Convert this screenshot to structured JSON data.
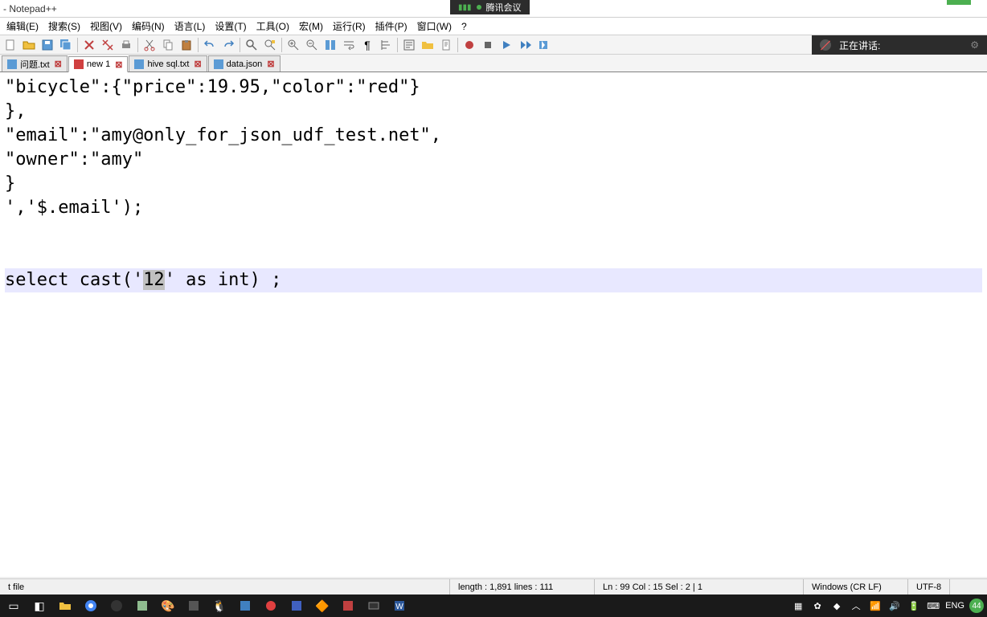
{
  "titlebar": {
    "title": "- Notepad++"
  },
  "meeting": {
    "app_name": "腾讯会议"
  },
  "menus": [
    {
      "label": "编辑(E)"
    },
    {
      "label": "搜索(S)"
    },
    {
      "label": "视图(V)"
    },
    {
      "label": "编码(N)"
    },
    {
      "label": "语言(L)"
    },
    {
      "label": "设置(T)"
    },
    {
      "label": "工具(O)"
    },
    {
      "label": "宏(M)"
    },
    {
      "label": "运行(R)"
    },
    {
      "label": "插件(P)"
    },
    {
      "label": "窗口(W)"
    },
    {
      "label": "?"
    }
  ],
  "speaking": {
    "label": "正在讲话:"
  },
  "tabs": [
    {
      "label": "问题.txt",
      "active": false
    },
    {
      "label": "new 1",
      "active": true,
      "dirty": true
    },
    {
      "label": "hive sql.txt",
      "active": false
    },
    {
      "label": "data.json",
      "active": false
    }
  ],
  "editor": {
    "lines": [
      "\"bicycle\":{\"price\":19.95,\"color\":\"red\"}",
      "},",
      "\"email\":\"amy@only_for_json_udf_test.net\",",
      "\"owner\":\"amy\"",
      "}",
      "','$.email');",
      "",
      ""
    ],
    "highlight_prefix": "select cast('",
    "highlight_sel": "12",
    "highlight_suffix": "' as int) ;"
  },
  "status": {
    "file_type": "t file",
    "stats": "length : 1,891    lines : 111",
    "pos": "Ln : 99    Col : 15    Sel : 2 | 1",
    "eol": "Windows (CR LF)",
    "encoding": "UTF-8"
  },
  "tray": {
    "ime": "ENG",
    "badge": "44"
  }
}
